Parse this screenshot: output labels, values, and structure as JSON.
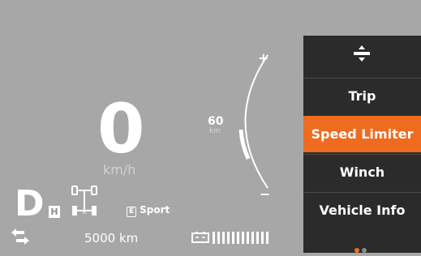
{
  "speedometer": {
    "value": "0",
    "unit": "km/h"
  },
  "gear": {
    "letter": "D",
    "range": "H"
  },
  "drive_mode": {
    "badge": "E",
    "label": "Sport"
  },
  "odometer": {
    "value": "5000 km"
  },
  "speed_limit_gauge": {
    "value": "60",
    "unit": "km",
    "increase_symbol": "+",
    "decrease_symbol": "−"
  },
  "menu": {
    "items": [
      {
        "label": "Trip"
      },
      {
        "label": "Speed Limiter"
      },
      {
        "label": "Winch"
      },
      {
        "label": "Vehicle Info"
      }
    ],
    "active_index": 1,
    "page_indicator": {
      "pages": 2,
      "current": 1
    }
  },
  "colors": {
    "accent": "#ef6b1f",
    "menu_bg": "#2b2b2b",
    "dash_bg": "#a7a7a7"
  }
}
